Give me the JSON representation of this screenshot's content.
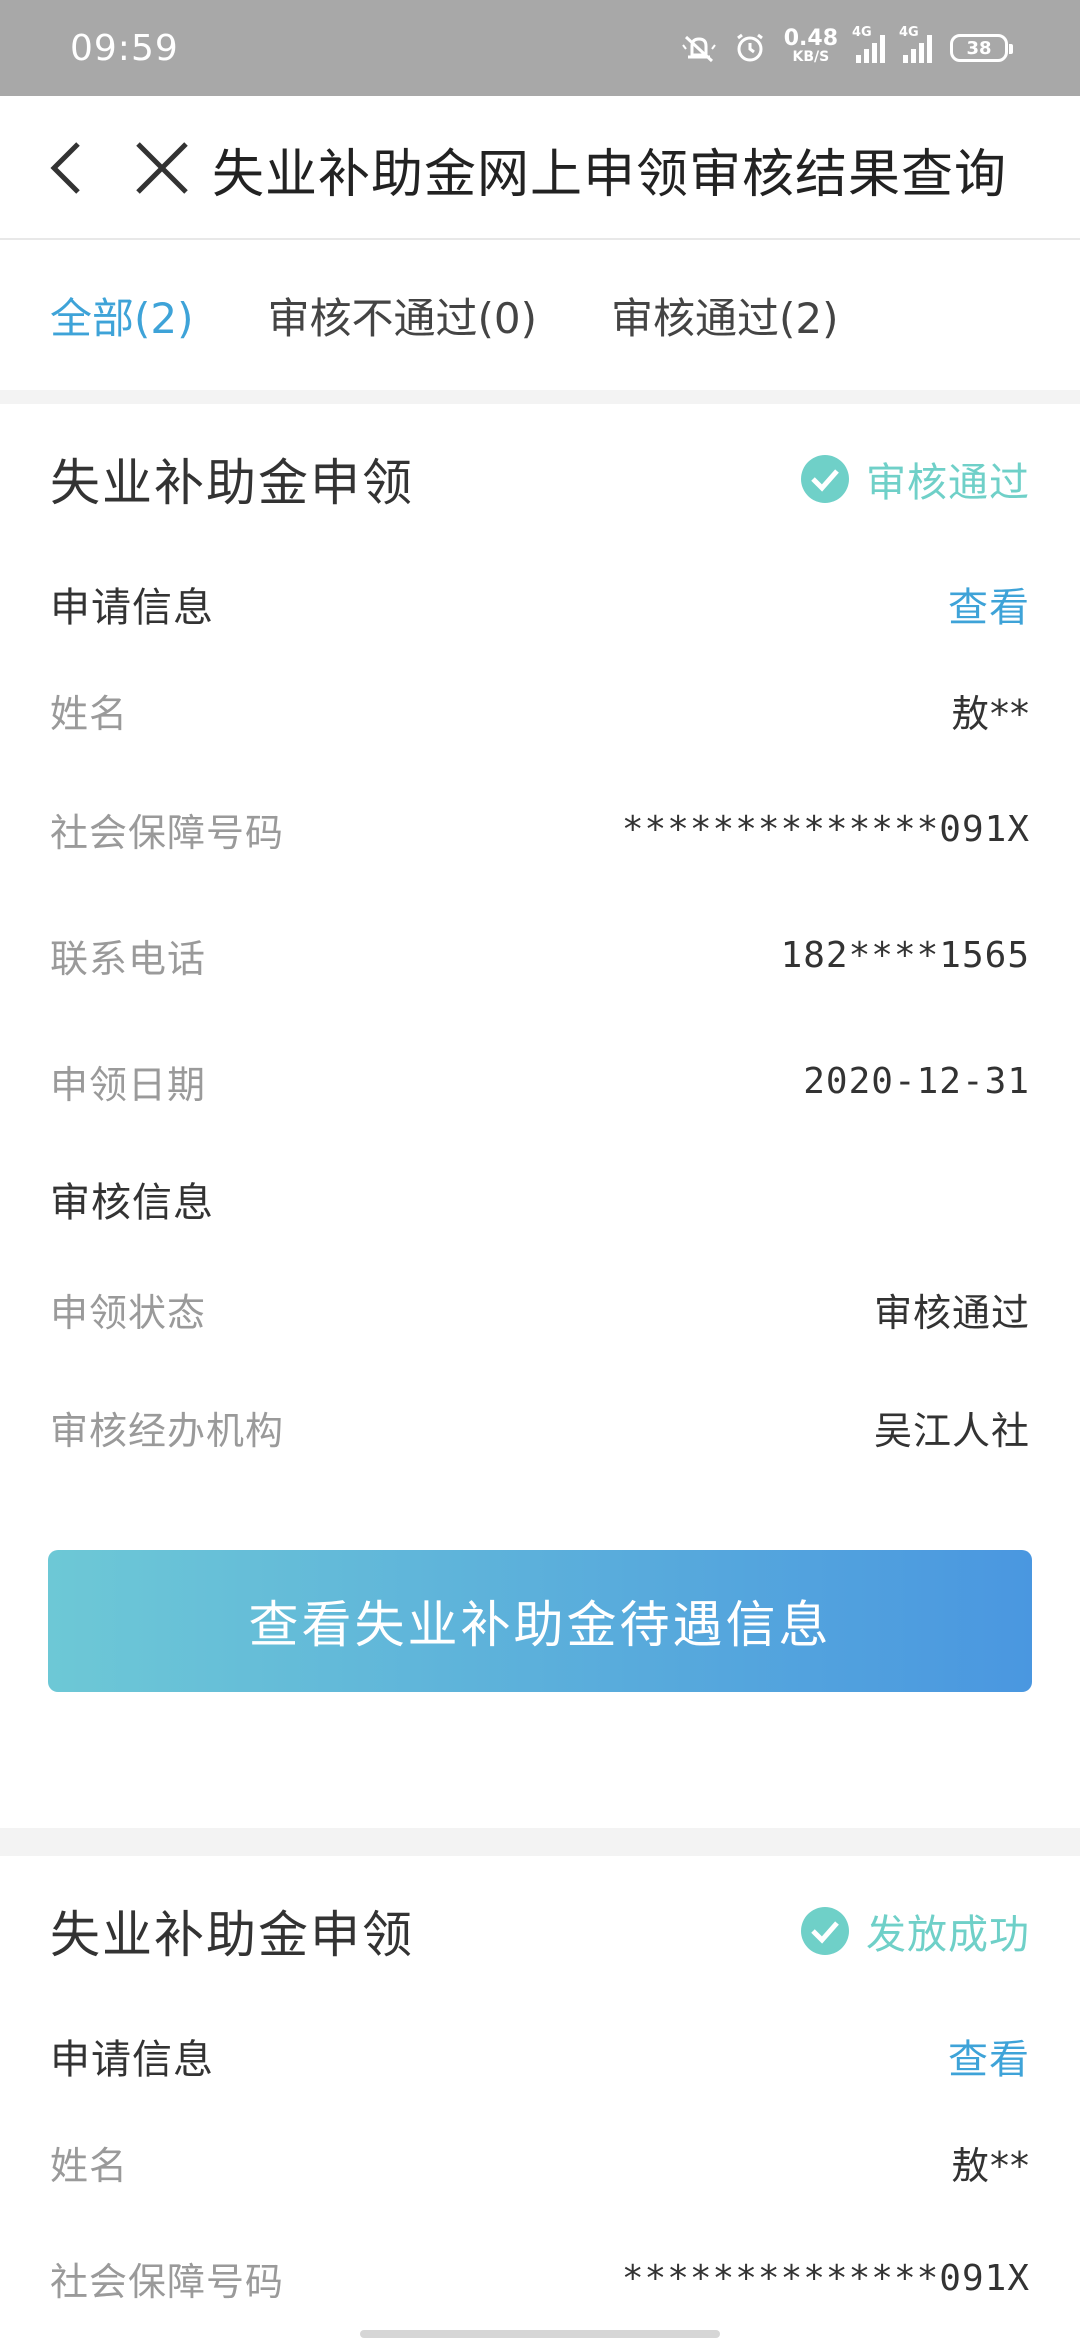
{
  "status_bar": {
    "time": "09:59",
    "net_speed": "0.48",
    "net_unit": "KB/S",
    "signal1_tag": "4G",
    "signal2_tag": "4G",
    "battery": "38"
  },
  "header": {
    "title": "失业补助金网上申领审核结果查询"
  },
  "tabs": [
    {
      "label": "全部(2)",
      "active": true
    },
    {
      "label": "审核不通过(0)",
      "active": false
    },
    {
      "label": "审核通过(2)",
      "active": false
    }
  ],
  "colors": {
    "accent": "#3ea3d8",
    "status_green": "#6fd0c8"
  },
  "cards": [
    {
      "title": "失业补助金申领",
      "status": "审核通过",
      "apply_section": {
        "title": "申请信息",
        "view_link": "查看",
        "rows": [
          {
            "label": "姓名",
            "value": "敖**"
          },
          {
            "label": "社会保障号码",
            "value": "**************091X"
          },
          {
            "label": "联系电话",
            "value": "182****1565"
          },
          {
            "label": "申领日期",
            "value": "2020-12-31"
          }
        ]
      },
      "review_section": {
        "title": "审核信息",
        "rows": [
          {
            "label": "申领状态",
            "value": "审核通过"
          },
          {
            "label": "审核经办机构",
            "value": "吴江人社"
          }
        ]
      },
      "button_label": "查看失业补助金待遇信息"
    },
    {
      "title": "失业补助金申领",
      "status": "发放成功",
      "apply_section": {
        "title": "申请信息",
        "view_link": "查看",
        "rows": [
          {
            "label": "姓名",
            "value": "敖**"
          },
          {
            "label": "社会保障号码",
            "value": "**************091X"
          }
        ]
      }
    }
  ]
}
